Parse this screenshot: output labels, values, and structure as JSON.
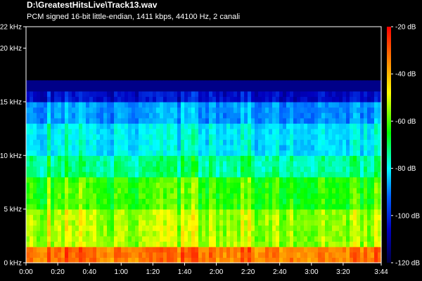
{
  "header": {
    "title": "D:\\GreatestHitsLive\\Track13.wav",
    "subtitle": "PCM signed 16-bit little-endian, 1411 kbps, 44100 Hz, 2 canali"
  },
  "chart_data": {
    "type": "heatmap",
    "title": "D:\\GreatestHitsLive\\Track13.wav",
    "subtitle": "PCM signed 16-bit little-endian, 1411 kbps, 44100 Hz, 2 canali",
    "x_axis": {
      "unit": "time",
      "range_seconds": [
        0,
        224
      ],
      "ticks": [
        {
          "value": 0,
          "label": "0:00"
        },
        {
          "value": 20,
          "label": "0:20"
        },
        {
          "value": 40,
          "label": "0:40"
        },
        {
          "value": 60,
          "label": "1:00"
        },
        {
          "value": 80,
          "label": "1:20"
        },
        {
          "value": 100,
          "label": "1:40"
        },
        {
          "value": 120,
          "label": "2:00"
        },
        {
          "value": 140,
          "label": "2:20"
        },
        {
          "value": 160,
          "label": "2:40"
        },
        {
          "value": 180,
          "label": "3:00"
        },
        {
          "value": 200,
          "label": "3:20"
        },
        {
          "value": 224,
          "label": "3:44"
        }
      ]
    },
    "y_axis": {
      "unit": "kHz",
      "range": [
        0,
        22
      ],
      "ticks": [
        {
          "value": 0,
          "label": "0 kHz"
        },
        {
          "value": 5,
          "label": "5 kHz"
        },
        {
          "value": 10,
          "label": "10 kHz"
        },
        {
          "value": 15,
          "label": "15 kHz"
        },
        {
          "value": 20,
          "label": "20 kHz"
        },
        {
          "value": 22,
          "label": "22 kHz"
        }
      ]
    },
    "colorbar": {
      "unit": "dB",
      "range": [
        -120,
        -20
      ],
      "ticks": [
        {
          "value": -20,
          "label": "-20 dB"
        },
        {
          "value": -40,
          "label": "-40 dB"
        },
        {
          "value": -60,
          "label": "-60 dB"
        },
        {
          "value": -80,
          "label": "-80 dB"
        },
        {
          "value": -100,
          "label": "-100 dB"
        },
        {
          "value": -120,
          "label": "-120 dB"
        }
      ],
      "gradient": [
        "#ff0000",
        "#ff8000",
        "#ffff00",
        "#00ff00",
        "#00ffff",
        "#0060ff",
        "#0000c0",
        "#000040"
      ]
    },
    "cutoff_khz": 16,
    "bands": [
      {
        "from_khz": 0,
        "to_khz": 1.5,
        "level_db": -35
      },
      {
        "from_khz": 1.5,
        "to_khz": 5,
        "level_db": -55
      },
      {
        "from_khz": 5,
        "to_khz": 7.8,
        "level_db": -62
      },
      {
        "from_khz": 7.8,
        "to_khz": 10,
        "level_db": -72
      },
      {
        "from_khz": 10,
        "to_khz": 13,
        "level_db": -80
      },
      {
        "from_khz": 13,
        "to_khz": 15,
        "level_db": -88
      },
      {
        "from_khz": 15,
        "to_khz": 16,
        "level_db": -105
      }
    ]
  }
}
